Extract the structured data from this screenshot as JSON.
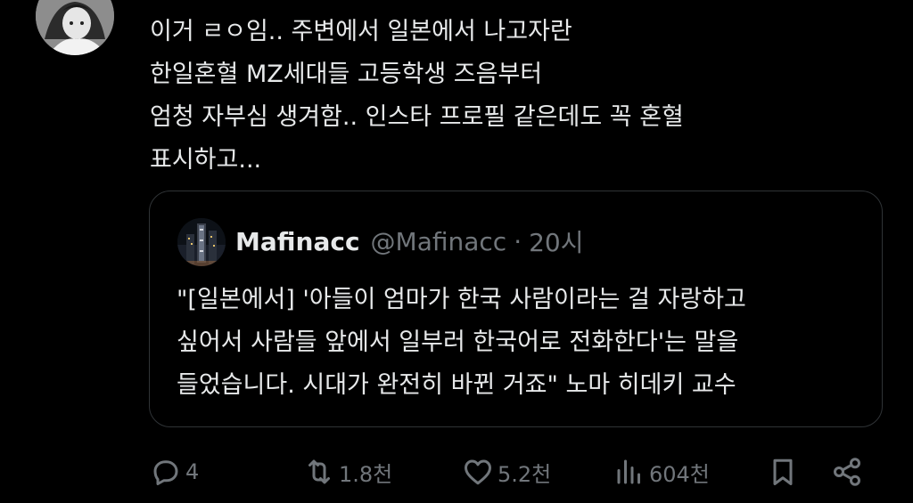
{
  "tweet": {
    "lines": [
      "이거 ㄹㅇ임.. 주변에서 일본에서 나고자란",
      "한일혼혈 MZ세대들 고등학생 즈음부터",
      "엄청 자부심 생겨함.. 인스타 프로필 같은데도 꼭 혼혈",
      "표시하고..."
    ]
  },
  "quote": {
    "name": "Mafinacc",
    "handle": "@Mafinacc",
    "separator": "·",
    "time": "20시",
    "lines": [
      "\"[일본에서] '아들이 엄마가 한국 사람이라는 걸 자랑하고",
      "싶어서 사람들 앞에서 일부러 한국어로 전화한다'는 말을",
      "들었습니다. 시대가 완전히 바뀐 거죠\" 노마 히데키 교수"
    ]
  },
  "actions": {
    "reply_count": "4",
    "retweet_count": "1.8천",
    "like_count": "5.2천",
    "view_count": "604천"
  },
  "icons": {
    "reply": "reply-icon",
    "retweet": "retweet-icon",
    "like": "heart-icon",
    "views": "views-icon",
    "bookmark": "bookmark-icon",
    "share": "share-icon"
  },
  "colors": {
    "background": "#000000",
    "text": "#e7e9ea",
    "secondary": "#71767b",
    "border": "#2f3336"
  }
}
